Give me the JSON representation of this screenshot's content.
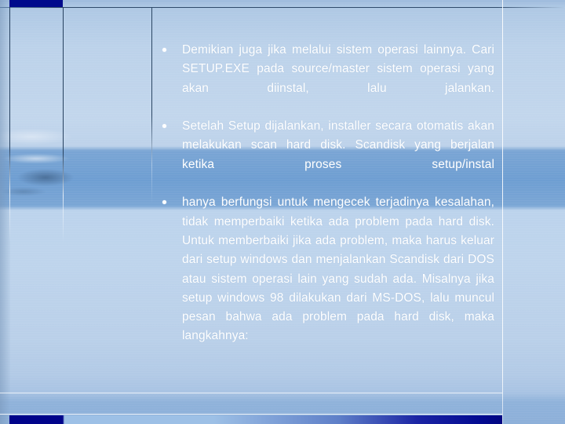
{
  "slide": {
    "background_color": "#b9cfe8",
    "accent_color": "#00038a",
    "text_color": "#ffffff",
    "bullets": [
      {
        "marker": "bullet-dot",
        "text": "Demikian juga jika melalui sistem operasi lainnya. Cari SETUP.EXE pada source/master sistem operasi yang akan diinstal, lalu jalankan."
      },
      {
        "marker": "bullet-dot",
        "text": "Setelah Setup dijalankan, installer secara otomatis akan melakukan scan hard disk. Scandisk yang berjalan ketika proses setup/instal"
      },
      {
        "marker": "bullet-dot",
        "text": "hanya berfungsi untuk mengecek terjadinya kesalahan, tidak memperbaiki ketika ada problem pada hard disk. Untuk memberbaiki jika ada problem, maka harus keluar dari setup windows dan menjalankan Scandisk dari DOS atau sistem operasi lain yang sudah ada. Misalnya jika setup windows 98 dilakukan dari MS-DOS, lalu muncul pesan bahwa ada problem pada hard disk, maka langkahnya:"
      }
    ]
  }
}
